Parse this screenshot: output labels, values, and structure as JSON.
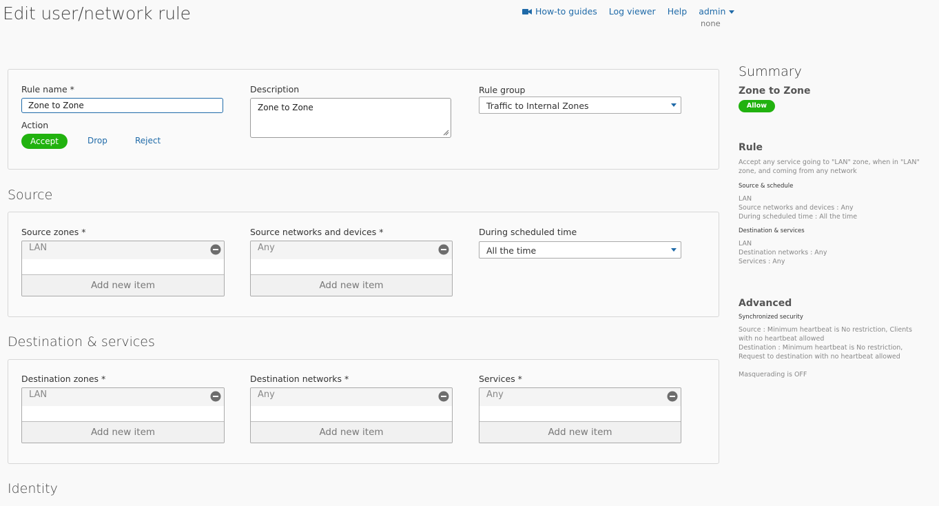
{
  "page": {
    "title": "Edit user/network rule"
  },
  "topnav": {
    "howto": "How-to guides",
    "logviewer": "Log viewer",
    "help": "Help",
    "user": "admin",
    "user_sub": "none"
  },
  "general": {
    "rule_name_label": "Rule name *",
    "rule_name_value": "Zone to Zone",
    "description_label": "Description",
    "description_value": "Zone to Zone",
    "rule_group_label": "Rule group",
    "rule_group_value": "Traffic to Internal Zones",
    "action_label": "Action",
    "actions": {
      "accept": "Accept",
      "drop": "Drop",
      "reject": "Reject"
    },
    "selected_action": "Accept"
  },
  "source": {
    "title": "Source",
    "zones_label": "Source zones *",
    "zones_item": "LAN",
    "networks_label": "Source networks and devices *",
    "networks_item": "Any",
    "schedule_label": "During scheduled time",
    "schedule_value": "All the time",
    "add_label": "Add new item"
  },
  "destination": {
    "title": "Destination & services",
    "zones_label": "Destination zones *",
    "zones_item": "LAN",
    "networks_label": "Destination networks *",
    "networks_item": "Any",
    "services_label": "Services *",
    "services_item": "Any",
    "add_label": "Add new item"
  },
  "identity": {
    "title": "Identity"
  },
  "summary": {
    "title": "Summary",
    "rule_name": "Zone to Zone",
    "badge": "Allow",
    "rule_heading": "Rule",
    "rule_text": "Accept any service going to \"LAN\" zone, when in \"LAN\" zone, and coming from any network",
    "source_heading": "Source & schedule",
    "source_lines": [
      "LAN",
      "Source networks and devices : Any",
      "During scheduled time : All the time"
    ],
    "dest_heading": "Destination & services",
    "dest_lines": [
      "LAN",
      "Destination networks : Any",
      "Services : Any"
    ],
    "advanced_heading": "Advanced",
    "sync_heading": "Synchronized security",
    "sync_source": "Source : Minimum heartbeat is No restriction, Clients with no heartbeat allowed",
    "sync_dest": "Destination : Minimum heartbeat is No restriction, Request to destination with no heartbeat allowed",
    "masquerading": "Masquerading is OFF"
  },
  "colors": {
    "accent": "#1f6aa8",
    "accept_green": "#21b20f"
  }
}
